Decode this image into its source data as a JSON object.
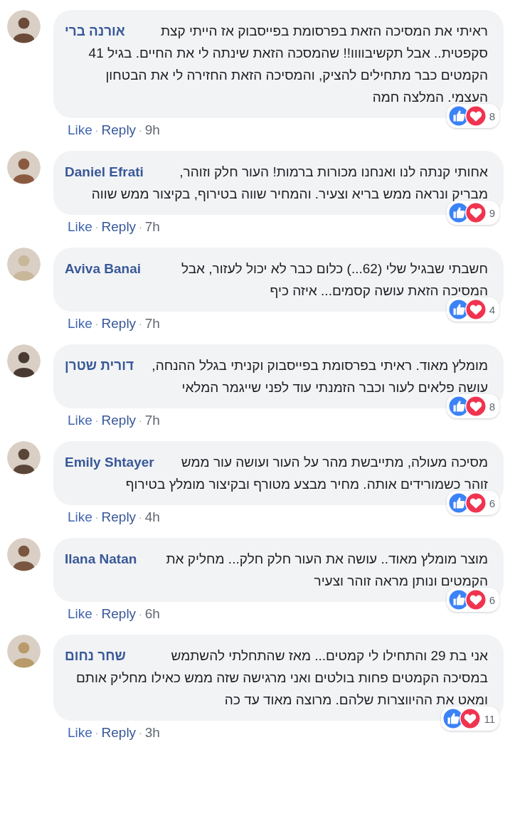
{
  "comments": [
    {
      "author": "אורנה ברי",
      "text": "ראיתי את המסיכה הזאת בפרסומת בפייסבוק אז הייתי קצת סקפטית.. אבל תקשיבוווו!! שהמסכה הזאת שינתה לי את החיים. בגיל 41 הקמטים כבר מתחילים להציק, והמסיכה הזאת החזירה לי את הבטחון העצמי. המלצה חמה",
      "reaction_count": "8",
      "like": "Like",
      "separator": "·",
      "reply": "Reply",
      "time": "9h"
    },
    {
      "author": "Daniel Efrati",
      "text": "אחותי קנתה לנו ואנחנו מכורות ברמות! העור חלק וזוהר, מבריק ונראה ממש בריא וצעיר. והמחיר שווה בטירוף, בקיצור ממש שווה",
      "reaction_count": "9",
      "like": "Like",
      "separator": "·",
      "reply": "Reply",
      "time": "7h"
    },
    {
      "author": "Aviva Banai",
      "text": "חשבתי שבגיל שלי (62...) כלום כבר לא יכול לעזור, אבל המסיכה הזאת עושה קסמים... איזה כיף",
      "reaction_count": "4",
      "like": "Like",
      "separator": "·",
      "reply": "Reply",
      "time": "7h"
    },
    {
      "author": "דורית שטרן",
      "text": "מומלץ מאוד. ראיתי בפרסומת בפייסבוק וקניתי בגלל ההנחה, עושה פלאים לעור וכבר הזמנתי עוד לפני שייגמר המלאי",
      "reaction_count": "8",
      "like": "Like",
      "separator": "·",
      "reply": "Reply",
      "time": "7h"
    },
    {
      "author": "Emily Shtayer",
      "text": "מסיכה מעולה, מתייבשת מהר על העור ועושה עור ממש זוהר כשמורידים אותה. מחיר מבצע מטורף ובקיצור מומלץ בטירוף",
      "reaction_count": "6",
      "like": "Like",
      "separator": "·",
      "reply": "Reply",
      "time": "4h"
    },
    {
      "author": "Ilana Natan",
      "text": "מוצר מומלץ מאוד.. עושה את העור חלק חלק... מחליק את הקמטים ונותן מראה זוהר וצעיר",
      "reaction_count": "6",
      "like": "Like",
      "separator": "·",
      "reply": "Reply",
      "time": "6h"
    },
    {
      "author": "שחר נחום",
      "text": "אני בת 29 והתחילו לי קמטים... מאז שהתחלתי להשתמש במסיכה הקמטים פחות בולטים ואני מרגישה שזה ממש כאילו מחליק אותם ומאט את ההיווצרות שלהם. מרוצה מאוד עד כה",
      "reaction_count": "11",
      "like": "Like",
      "separator": "·",
      "reply": "Reply",
      "time": "3h"
    }
  ]
}
